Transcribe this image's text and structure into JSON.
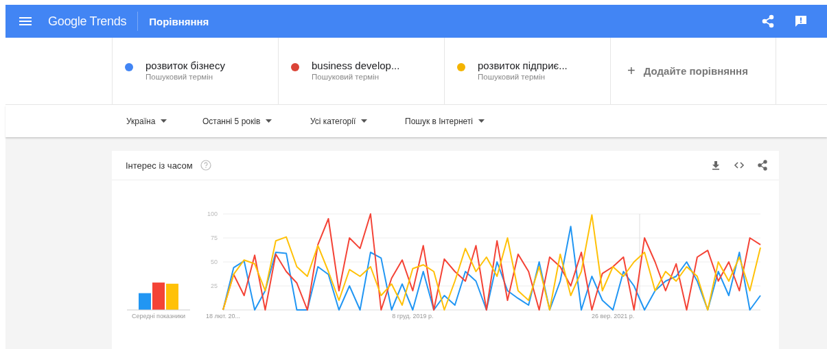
{
  "header": {
    "logo": "Google Trends",
    "title": "Порівняння"
  },
  "terms": [
    {
      "name": "розвиток бізнесу",
      "subtitle": "Пошуковий термін",
      "color": "#4285f4"
    },
    {
      "name": "business develop...",
      "subtitle": "Пошуковий термін",
      "color": "#db4437"
    },
    {
      "name": "розвиток підприє...",
      "subtitle": "Пошуковий термін",
      "color": "#f4b400"
    }
  ],
  "add_comparison": {
    "icon": "+",
    "label": "Додайте порівняння"
  },
  "filters": [
    "Україна",
    "Останні 5 років",
    "Усі категорії",
    "Пошук в Інтернеті"
  ],
  "interest_card": {
    "title": "Інтерес із часом",
    "averages_label": "Середні показники",
    "chart_data": {
      "type": "line",
      "categories": [
        "18 лют. 20...",
        null,
        null,
        null,
        null,
        null,
        null,
        null,
        null,
        null,
        null,
        null,
        null,
        null,
        null,
        null,
        null,
        null,
        "8 груд. 2019 р.",
        null,
        null,
        null,
        null,
        null,
        null,
        null,
        null,
        null,
        null,
        null,
        null,
        null,
        null,
        null,
        null,
        null,
        null,
        "26 вер. 2021 р.",
        null,
        null,
        null,
        null,
        null,
        null,
        null,
        null,
        null,
        null,
        null,
        null,
        null,
        null
      ],
      "ylim": [
        0,
        100
      ],
      "grid": true,
      "yticks": [
        25,
        50,
        75,
        100
      ],
      "series": [
        {
          "color": "#2196f3",
          "values": [
            0,
            44,
            51,
            0,
            20,
            60,
            59,
            0,
            0,
            45,
            37,
            0,
            25,
            0,
            60,
            54,
            0,
            27,
            0,
            40,
            0,
            15,
            5,
            40,
            30,
            0,
            50,
            20,
            12,
            5,
            50,
            0,
            30,
            87,
            0,
            35,
            10,
            0,
            40,
            25,
            0,
            20,
            30,
            35,
            50,
            30,
            0,
            40,
            15,
            60,
            0,
            15
          ]
        },
        {
          "color": "#f44336",
          "values": [
            0,
            37,
            15,
            57,
            0,
            58,
            40,
            28,
            0,
            68,
            95,
            20,
            75,
            64,
            100,
            0,
            33,
            52,
            20,
            67,
            0,
            53,
            40,
            30,
            67,
            0,
            72,
            10,
            58,
            40,
            0,
            55,
            45,
            25,
            60,
            0,
            38,
            45,
            55,
            0,
            75,
            50,
            20,
            48,
            0,
            55,
            62,
            30,
            50,
            20,
            75,
            68
          ]
        },
        {
          "color": "#ffc107",
          "values": [
            0,
            37,
            52,
            48,
            20,
            72,
            76,
            45,
            35,
            67,
            40,
            10,
            42,
            35,
            45,
            15,
            27,
            5,
            43,
            47,
            40,
            0,
            30,
            64,
            40,
            55,
            35,
            75,
            20,
            10,
            45,
            0,
            58,
            15,
            40,
            99,
            20,
            45,
            35,
            50,
            60,
            20,
            40,
            30,
            45,
            35,
            0,
            50,
            30,
            55,
            20,
            65
          ]
        }
      ]
    }
  }
}
